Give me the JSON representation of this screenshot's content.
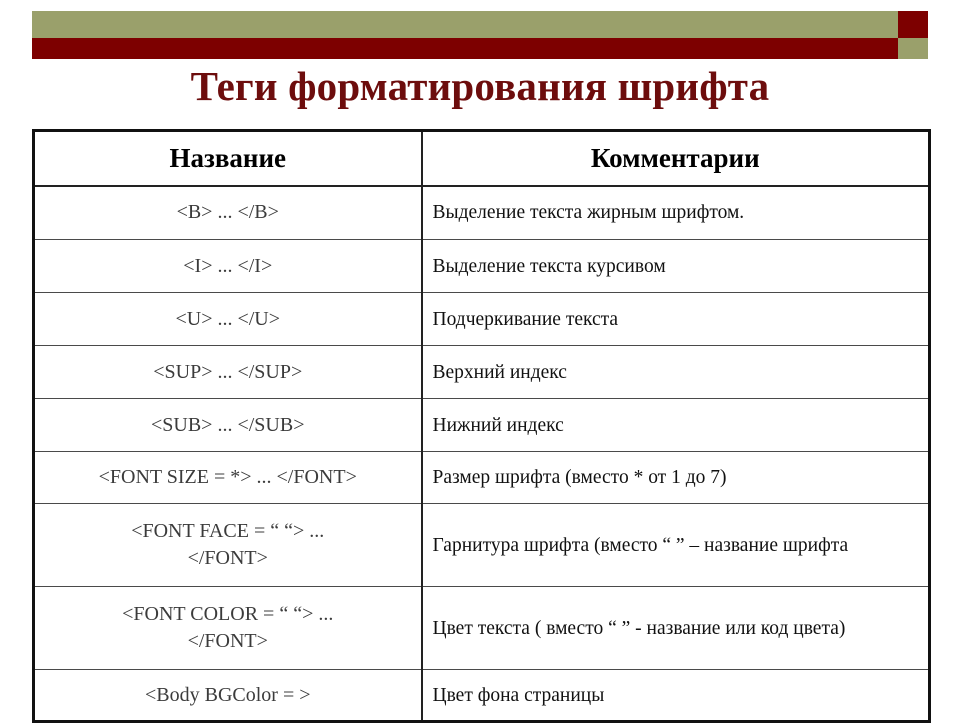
{
  "slide": {
    "title": "Теги форматирования шрифта",
    "title_color": "#6d0d0d",
    "accent_green": "#9aa06b",
    "accent_red": "#7d0000"
  },
  "table": {
    "headers": {
      "name": "Название",
      "comment": "Комментарии"
    },
    "rows": [
      {
        "name": "<B> ... </B>",
        "comment": "Выделение текста жирным шрифтом."
      },
      {
        "name": "<I> ... </I>",
        "comment": "Выделение текста курсивом"
      },
      {
        "name": "<U> ... </U>",
        "comment": "Подчеркивание текста"
      },
      {
        "name": "<SUP> ... </SUP>",
        "comment": "Верхний индекс"
      },
      {
        "name": "<SUB> ... </SUB>",
        "comment": "Нижний индекс"
      },
      {
        "name": "<FONT SIZE = *> ... </FONT>",
        "comment": "Размер шрифта (вместо * от 1 до 7)"
      },
      {
        "name": "<FONT FACE = “ “> ...\n</FONT>",
        "comment": "Гарнитура шрифта (вместо “ ” – название шрифта"
      },
      {
        "name": "<FONT COLOR = “ “> ...\n</FONT>",
        "comment": "Цвет текста ( вместо “ ” -  название или код цвета)"
      },
      {
        "name": "<Body BGColor = >",
        "comment": "Цвет фона страницы"
      }
    ]
  }
}
